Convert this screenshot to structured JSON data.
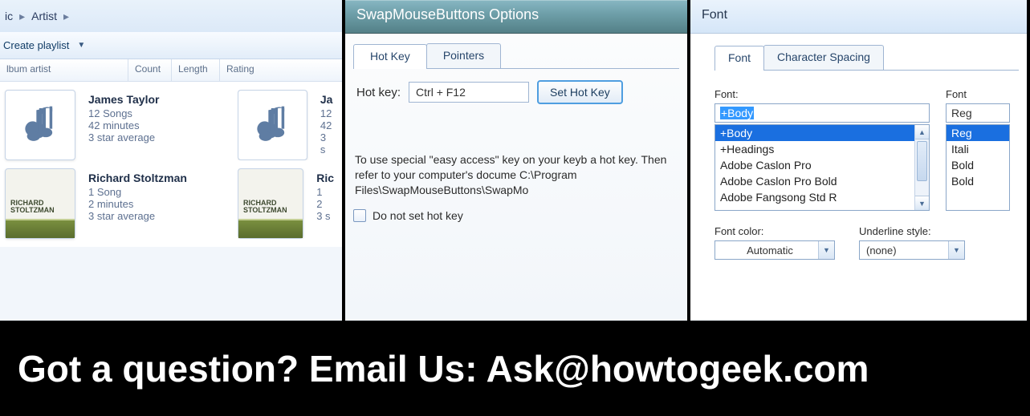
{
  "panel1": {
    "breadcrumb": [
      "ic",
      "Artist",
      ""
    ],
    "toolbar": {
      "create_playlist": "Create playlist"
    },
    "headers": {
      "c1": "lbum artist",
      "c2": "Count",
      "c3": "Length",
      "c4": "Rating"
    },
    "albums": [
      {
        "artist": "James Taylor",
        "songs": "12 Songs",
        "duration": "42 minutes",
        "rating": "3 star average",
        "art": "note"
      },
      {
        "artist": "Ja",
        "songs": "12",
        "duration": "42",
        "rating": "3 s",
        "art": "note"
      },
      {
        "artist": "Richard Stoltzman",
        "songs": "1 Song",
        "duration": "2 minutes",
        "rating": "3 star average",
        "art": "richard"
      },
      {
        "artist": "Ric",
        "songs": "1",
        "duration": "2",
        "rating": "3 s",
        "art": "richard"
      }
    ],
    "art_text": {
      "top": "RICHARD STOLTZMAN",
      "mid1": "RICHARD",
      "mid2": "STOLTZMAN"
    }
  },
  "panel2": {
    "title": "SwapMouseButtons Options",
    "tabs": {
      "hotkey": "Hot Key",
      "pointers": "Pointers"
    },
    "hotkey_label": "Hot key:",
    "hotkey_value": "Ctrl + F12",
    "set_btn": "Set Hot Key",
    "help_text": "To use special \"easy access\" key on your keyb a hot key. Then refer to your computer's docume C:\\Program Files\\SwapMouseButtons\\SwapMo",
    "checkbox_label": "Do not set hot key"
  },
  "panel3": {
    "title": "Font",
    "tabs": {
      "font": "Font",
      "spacing": "Character Spacing"
    },
    "font_label": "Font:",
    "font_value": "+Body",
    "font_list": [
      "+Body",
      "+Headings",
      "Adobe Caslon Pro",
      "Adobe Caslon Pro Bold",
      "Adobe Fangsong Std R"
    ],
    "style_label": "Font",
    "style_value": "Reg",
    "style_list": [
      "Reg",
      "Itali",
      "Bold",
      "Bold"
    ],
    "fontcolor_label": "Font color:",
    "fontcolor_value": "Automatic",
    "underline_label": "Underline style:",
    "underline_value": "(none)"
  },
  "footer": {
    "text": "Got a question? Email Us: Ask@howtogeek.com"
  }
}
